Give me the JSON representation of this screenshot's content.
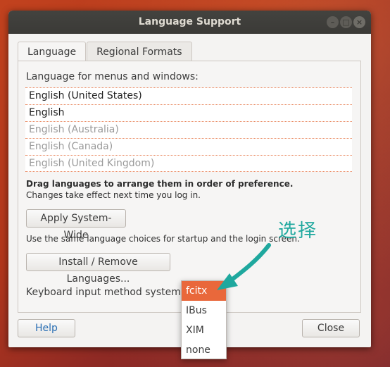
{
  "window": {
    "title": "Language Support",
    "controls": [
      "minimize-icon",
      "maximize-icon",
      "close-icon"
    ]
  },
  "tabs": [
    {
      "label": "Language",
      "active": true
    },
    {
      "label": "Regional Formats",
      "active": false
    }
  ],
  "languages": {
    "heading": "Language for menus and windows:",
    "items": [
      {
        "label": "English (United States)",
        "enabled": true
      },
      {
        "label": "English",
        "enabled": true
      },
      {
        "label": "English (Australia)",
        "enabled": false
      },
      {
        "label": "English (Canada)",
        "enabled": false
      },
      {
        "label": "English (United Kingdom)",
        "enabled": false
      }
    ]
  },
  "hints": {
    "drag": "Drag languages to arrange them in order of preference.",
    "effect": "Changes take effect next time you log in."
  },
  "apply": {
    "label": "Apply System-Wide",
    "description": "Use the same language choices for startup and the login screen."
  },
  "install": {
    "label": "Install / Remove Languages..."
  },
  "keyboard": {
    "label": "Keyboard input method system:",
    "options": [
      "fcitx",
      "IBus",
      "XIM",
      "none"
    ],
    "selected": "fcitx"
  },
  "footer": {
    "help": "Help",
    "close": "Close"
  },
  "annotation": {
    "text": "选择",
    "color": "#1fa89e"
  },
  "colors": {
    "accent": "#e9683b",
    "titlebar": "#3b3a37"
  }
}
